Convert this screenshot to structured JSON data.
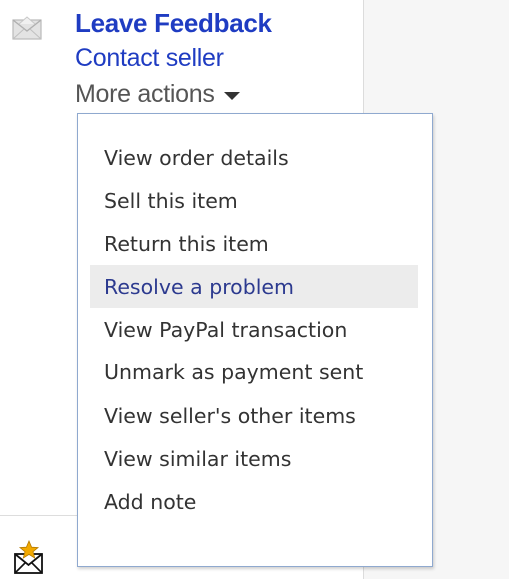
{
  "actions": {
    "leave_feedback": "Leave Feedback",
    "contact_seller": "Contact seller",
    "more_actions": "More actions"
  },
  "menu": {
    "items": [
      {
        "label": "View order details"
      },
      {
        "label": "Sell this item"
      },
      {
        "label": "Return this item"
      },
      {
        "label": "Resolve a problem",
        "highlighted": true
      },
      {
        "label": "View PayPal transaction"
      },
      {
        "label": "Unmark as payment sent"
      },
      {
        "label": "View seller's other items"
      },
      {
        "label": "View similar items"
      },
      {
        "label": "Add note"
      }
    ]
  },
  "icons": {
    "top_row": "envelope-icon",
    "bottom_row": "envelope-star-icon",
    "more_actions_caret": "caret-down-icon"
  },
  "colors": {
    "link_blue": "#1f3cc2",
    "menu_hover_bg": "#ececec",
    "menu_hover_text": "#2c3a8f",
    "menu_border": "#8fa9cf",
    "star": "#f2a900"
  }
}
